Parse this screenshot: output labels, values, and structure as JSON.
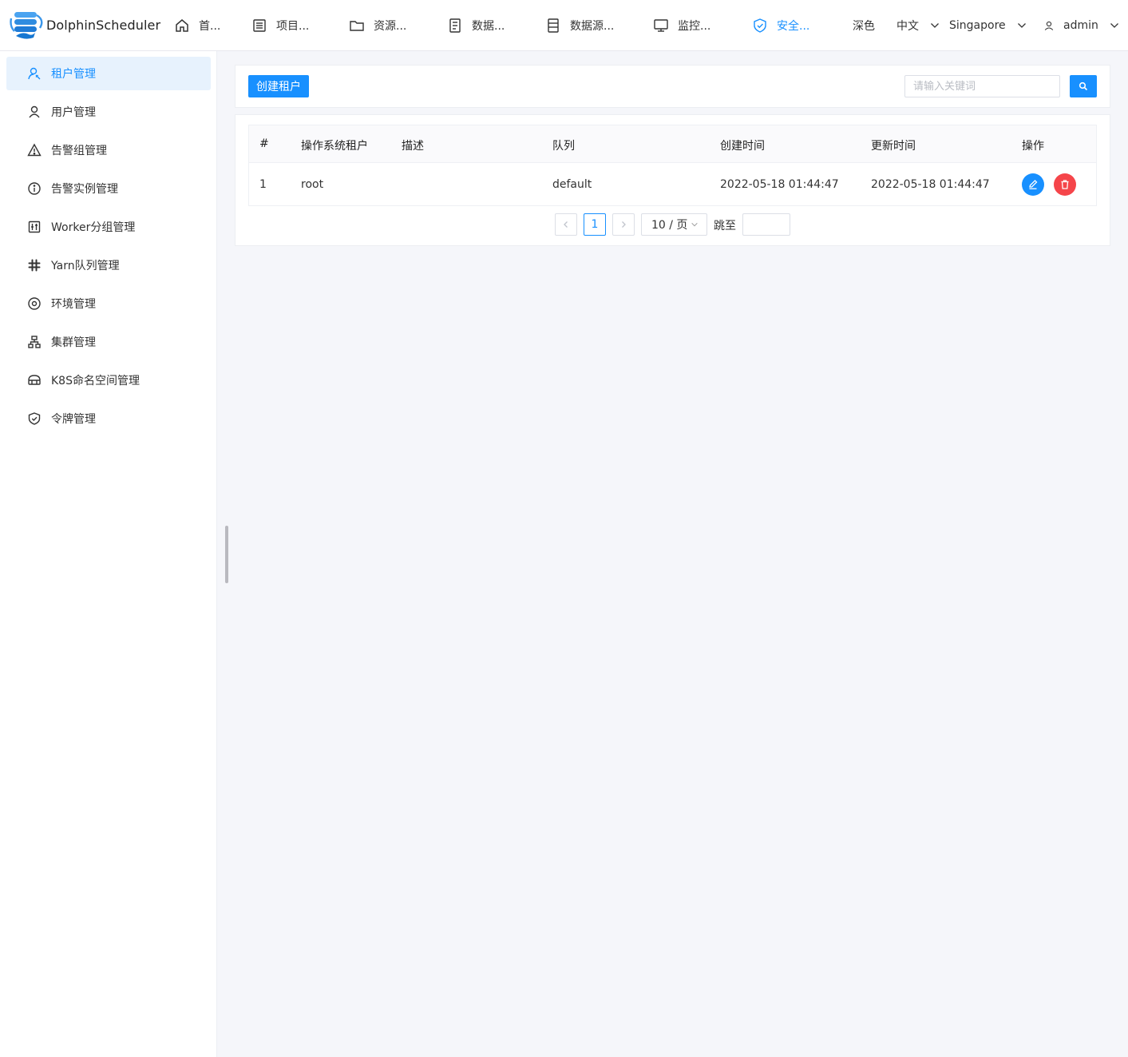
{
  "header": {
    "app_name": "DolphinScheduler",
    "nav": [
      {
        "label": "首...",
        "icon": "home-icon"
      },
      {
        "label": "项目...",
        "icon": "project-icon"
      },
      {
        "label": "资源...",
        "icon": "folder-icon"
      },
      {
        "label": "数据...",
        "icon": "data-icon"
      },
      {
        "label": "数据源...",
        "icon": "datasource-icon"
      },
      {
        "label": "监控...",
        "icon": "monitor-icon"
      },
      {
        "label": "安全...",
        "icon": "shield-check-icon",
        "active": true
      }
    ],
    "theme_label": "深色",
    "language_label": "中文",
    "timezone_label": "Singapore",
    "user_label": "admin"
  },
  "sidebar": {
    "items": [
      {
        "label": "租户管理",
        "icon": "tenant-icon",
        "active": true
      },
      {
        "label": "用户管理",
        "icon": "user-icon"
      },
      {
        "label": "告警组管理",
        "icon": "warning-triangle-icon"
      },
      {
        "label": "告警实例管理",
        "icon": "info-circle-icon"
      },
      {
        "label": "Worker分组管理",
        "icon": "worker-group-icon"
      },
      {
        "label": "Yarn队列管理",
        "icon": "slack-icon"
      },
      {
        "label": "环境管理",
        "icon": "location-pin-icon"
      },
      {
        "label": "集群管理",
        "icon": "cluster-icon"
      },
      {
        "label": "K8S命名空间管理",
        "icon": "k8s-namespace-icon"
      },
      {
        "label": "令牌管理",
        "icon": "token-shield-icon"
      }
    ]
  },
  "toolbar": {
    "create_label": "创建租户",
    "search_placeholder": "请输入关键词"
  },
  "table": {
    "columns": [
      "#",
      "操作系统租户",
      "描述",
      "队列",
      "创建时间",
      "更新时间",
      "操作"
    ],
    "rows": [
      {
        "index": "1",
        "tenant": "root",
        "description": "",
        "queue": "default",
        "created": "2022-05-18 01:44:47",
        "updated": "2022-05-18 01:44:47"
      }
    ]
  },
  "pagination": {
    "current_page": "1",
    "page_size_label": "10 / 页",
    "jump_label": "跳至",
    "jump_value": ""
  },
  "colors": {
    "primary": "#1890ff",
    "danger": "#f5454a",
    "active_bg": "#e7f2fd"
  }
}
